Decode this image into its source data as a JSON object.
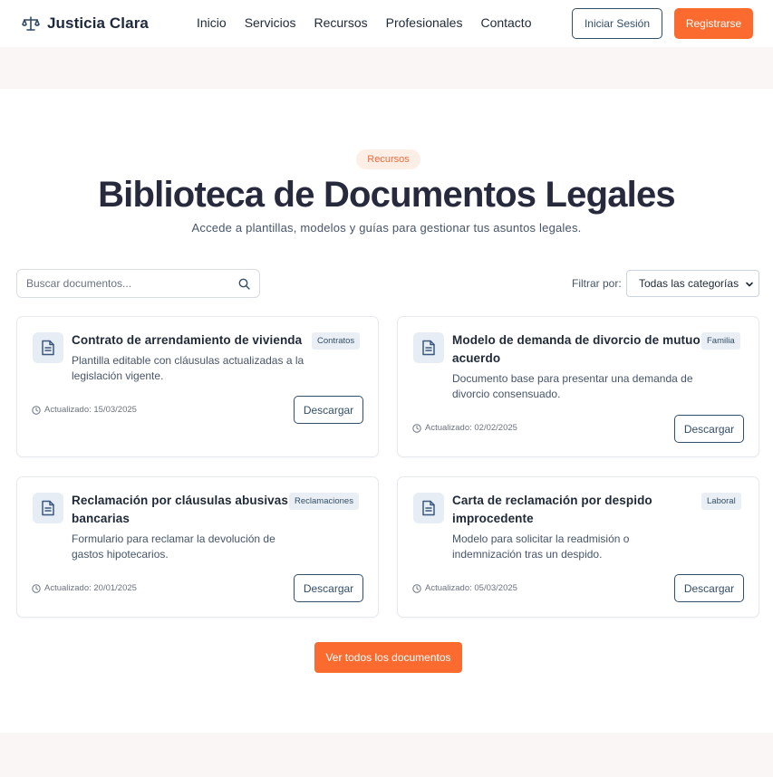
{
  "header": {
    "brand": "Justicia Clara",
    "nav": [
      "Inicio",
      "Servicios",
      "Recursos",
      "Profesionales",
      "Contacto"
    ],
    "login_label": "Iniciar Sesión",
    "register_label": "Registrarse"
  },
  "hero": {
    "badge": "Recursos",
    "title": "Biblioteca de Documentos Legales",
    "subtitle": "Accede a plantillas, modelos y guías para gestionar tus asuntos legales."
  },
  "search": {
    "placeholder": "Buscar documentos...",
    "value": ""
  },
  "filter": {
    "label": "Filtrar por:",
    "selected": "Todas las categorías"
  },
  "documents": [
    {
      "title": "Contrato de arrendamiento de vivienda",
      "tag": "Contratos",
      "description": "Plantilla editable con cláusulas actualizadas a la legislación vigente.",
      "updated": "Actualizado: 15/03/2025",
      "download_label": "Descargar"
    },
    {
      "title": "Modelo de demanda de divorcio de mutuo acuerdo",
      "tag": "Familia",
      "description": "Documento base para presentar una demanda de divorcio consensuado.",
      "updated": "Actualizado: 02/02/2025",
      "download_label": "Descargar"
    },
    {
      "title": "Reclamación por cláusulas abusivas bancarias",
      "tag": "Reclamaciones",
      "description": "Formulario para reclamar la devolución de gastos hipotecarios.",
      "updated": "Actualizado: 20/01/2025",
      "download_label": "Descargar"
    },
    {
      "title": "Carta de reclamación por despido improcedente",
      "tag": "Laboral",
      "description": "Modelo para solicitar la readmisión o indemnización tras un despido.",
      "updated": "Actualizado: 05/03/2025",
      "download_label": "Descargar"
    }
  ],
  "view_all_label": "Ver todos los documentos",
  "colors": {
    "accent": "#fb6b2f",
    "primary": "#334e68",
    "heading": "#27293d",
    "band": "#faf6f6"
  },
  "icons": {
    "logo": "scale-icon",
    "search": "search-icon",
    "document": "document-icon",
    "clock": "clock-icon",
    "select": "chevron-down-icon"
  }
}
